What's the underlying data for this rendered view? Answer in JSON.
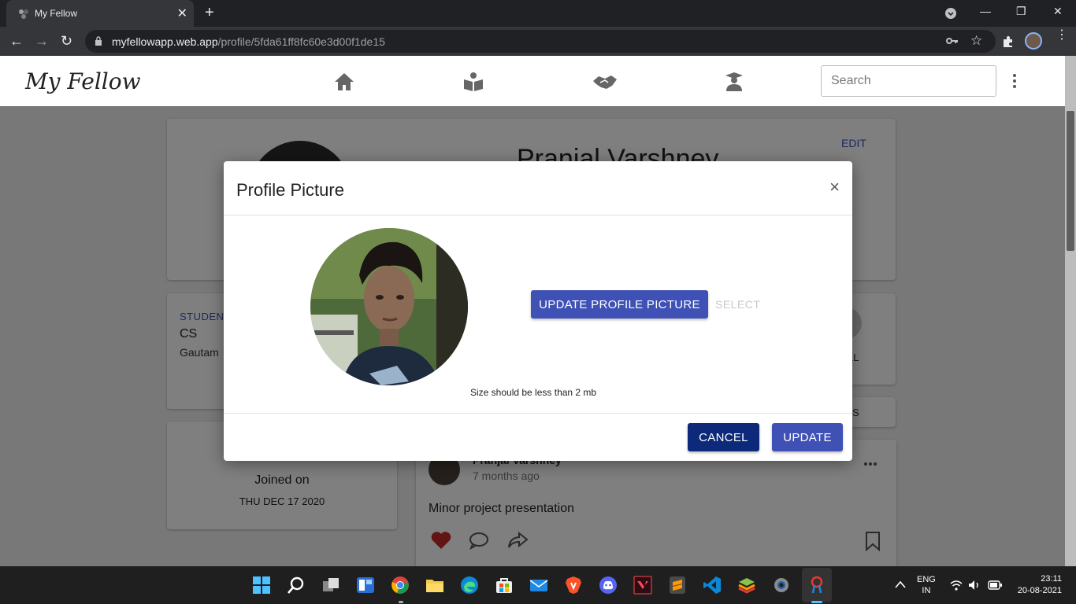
{
  "browser": {
    "tab_title": "My Fellow",
    "url_host": "myfellowapp.web.app",
    "url_path": "/profile/5fda61ff8fc60e3d00f1de15"
  },
  "app": {
    "logo": "My Fellow",
    "nav_icons": [
      "home-icon",
      "book-reader-icon",
      "handshake-icon",
      "graduate-icon"
    ],
    "search_placeholder": "Search"
  },
  "page": {
    "profile_name": "Pranjal Varshney",
    "edit_label": "EDIT",
    "student_label": "STUDEN",
    "branch": "CS",
    "college": "Gautam",
    "all_label": "LL",
    "bookmarks_label": "RKS",
    "joined_label": "Joined on",
    "joined_date": "THU DEC 17 2020",
    "post": {
      "author": "Pranjal Varshney",
      "time": "7 months ago",
      "text": "Minor project presentation"
    }
  },
  "modal": {
    "title": "Profile Picture",
    "close": "×",
    "update_picture_label": "UPDATE PROFILE PICTURE",
    "select_label": "SELECT",
    "size_note": "Size should be less than 2 mb",
    "cancel_label": "CANCEL",
    "update_label": "UPDATE"
  },
  "taskbar": {
    "lang_line1": "ENG",
    "lang_line2": "IN",
    "time": "23:11",
    "date": "20-08-2021"
  },
  "colors": {
    "primary": "#3f51b5",
    "cancel": "#0d2a7a",
    "heart": "#c62828"
  }
}
